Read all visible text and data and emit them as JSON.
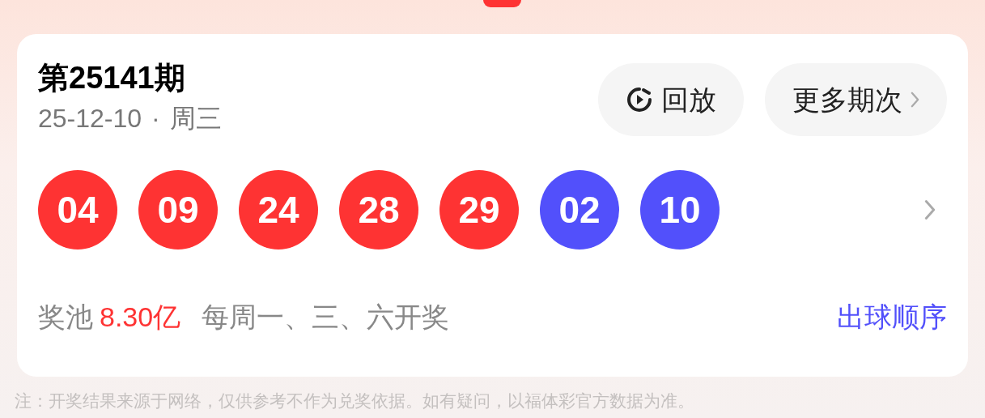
{
  "issue": {
    "title": "第25141期",
    "date": "25-12-10",
    "separator": "·",
    "weekday": "周三"
  },
  "buttons": [
    {
      "kind": "replay",
      "label": "回放"
    },
    {
      "kind": "more",
      "label": "更多期次"
    }
  ],
  "balls": [
    {
      "number": "04",
      "color": "#fe3333"
    },
    {
      "number": "09",
      "color": "#fe3333"
    },
    {
      "number": "24",
      "color": "#fe3333"
    },
    {
      "number": "28",
      "color": "#fe3333"
    },
    {
      "number": "29",
      "color": "#fe3333"
    },
    {
      "number": "02",
      "color": "#5250fb"
    },
    {
      "number": "10",
      "color": "#5250fb"
    }
  ],
  "pool": {
    "label": "奖池",
    "amount": "8.30亿",
    "schedule": "每周一、三、六开奖"
  },
  "order_link": "出球顺序",
  "footnote": "注：开奖结果来源于网络，仅供参考不作为兑奖依据。如有疑问，以福体彩官方数据为准。"
}
